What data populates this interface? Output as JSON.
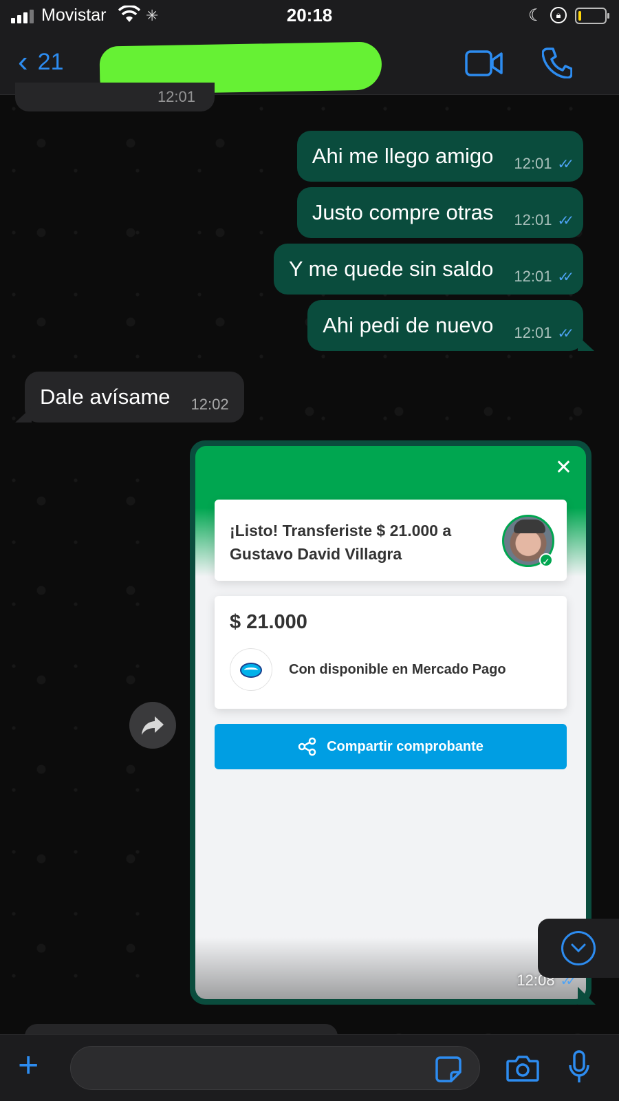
{
  "status_bar": {
    "carrier": "Movistar",
    "time": "20:18"
  },
  "header": {
    "back_count": "21",
    "contact_name": ""
  },
  "messages": [
    {
      "direction": "incoming-partial",
      "time": "12:01"
    },
    {
      "direction": "outgoing",
      "text": "Ahi me llego amigo",
      "time": "12:01",
      "read": true
    },
    {
      "direction": "outgoing",
      "text": "Justo compre otras",
      "time": "12:01",
      "read": true
    },
    {
      "direction": "outgoing",
      "text": "Y me quede sin saldo",
      "time": "12:01",
      "read": true
    },
    {
      "direction": "outgoing",
      "text": "Ahi pedi de nuevo",
      "time": "12:01",
      "read": true
    },
    {
      "direction": "incoming",
      "text": "Dale avísame",
      "time": "12:02"
    }
  ],
  "image_message": {
    "time": "12:08",
    "read": true,
    "receipt": {
      "title": "¡Listo! Transferiste $ 21.000 a Gustavo David Villagra",
      "amount": "$ 21.000",
      "method": "Con disponible en Mercado Pago",
      "share_label": "Compartir comprobante",
      "close_icon": "close-icon",
      "brand_color": "#00a650",
      "button_color": "#009ee3"
    }
  },
  "input_bar": {
    "placeholder": ""
  },
  "colors": {
    "accent": "#2d8cf0",
    "outgoing_bubble": "#0a4c3d",
    "incoming_bubble": "#262628",
    "read_ticks": "#4ea3f5"
  }
}
